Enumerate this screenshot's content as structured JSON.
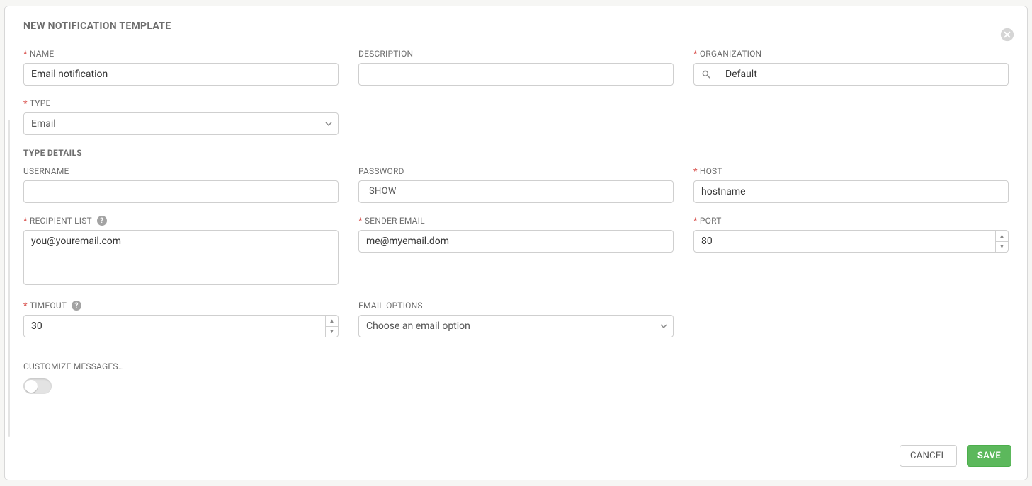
{
  "title": "NEW NOTIFICATION TEMPLATE",
  "labels": {
    "name": "NAME",
    "description": "DESCRIPTION",
    "organization": "ORGANIZATION",
    "type": "TYPE",
    "type_details": "TYPE DETAILS",
    "username": "USERNAME",
    "password": "PASSWORD",
    "host": "HOST",
    "recipient_list": "RECIPIENT LIST",
    "sender_email": "SENDER EMAIL",
    "port": "PORT",
    "timeout": "TIMEOUT",
    "email_options": "EMAIL OPTIONS",
    "customize": "CUSTOMIZE MESSAGES…"
  },
  "values": {
    "name": "Email notification",
    "description": "",
    "organization": "Default",
    "type": "Email",
    "username": "",
    "password": "",
    "host": "hostname",
    "recipient_list": "you@youremail.com",
    "sender_email": "me@myemail.dom",
    "port": "80",
    "timeout": "30",
    "email_options": "Choose an email option"
  },
  "buttons": {
    "show": "SHOW",
    "cancel": "CANCEL",
    "save": "SAVE"
  },
  "help_glyph": "?"
}
